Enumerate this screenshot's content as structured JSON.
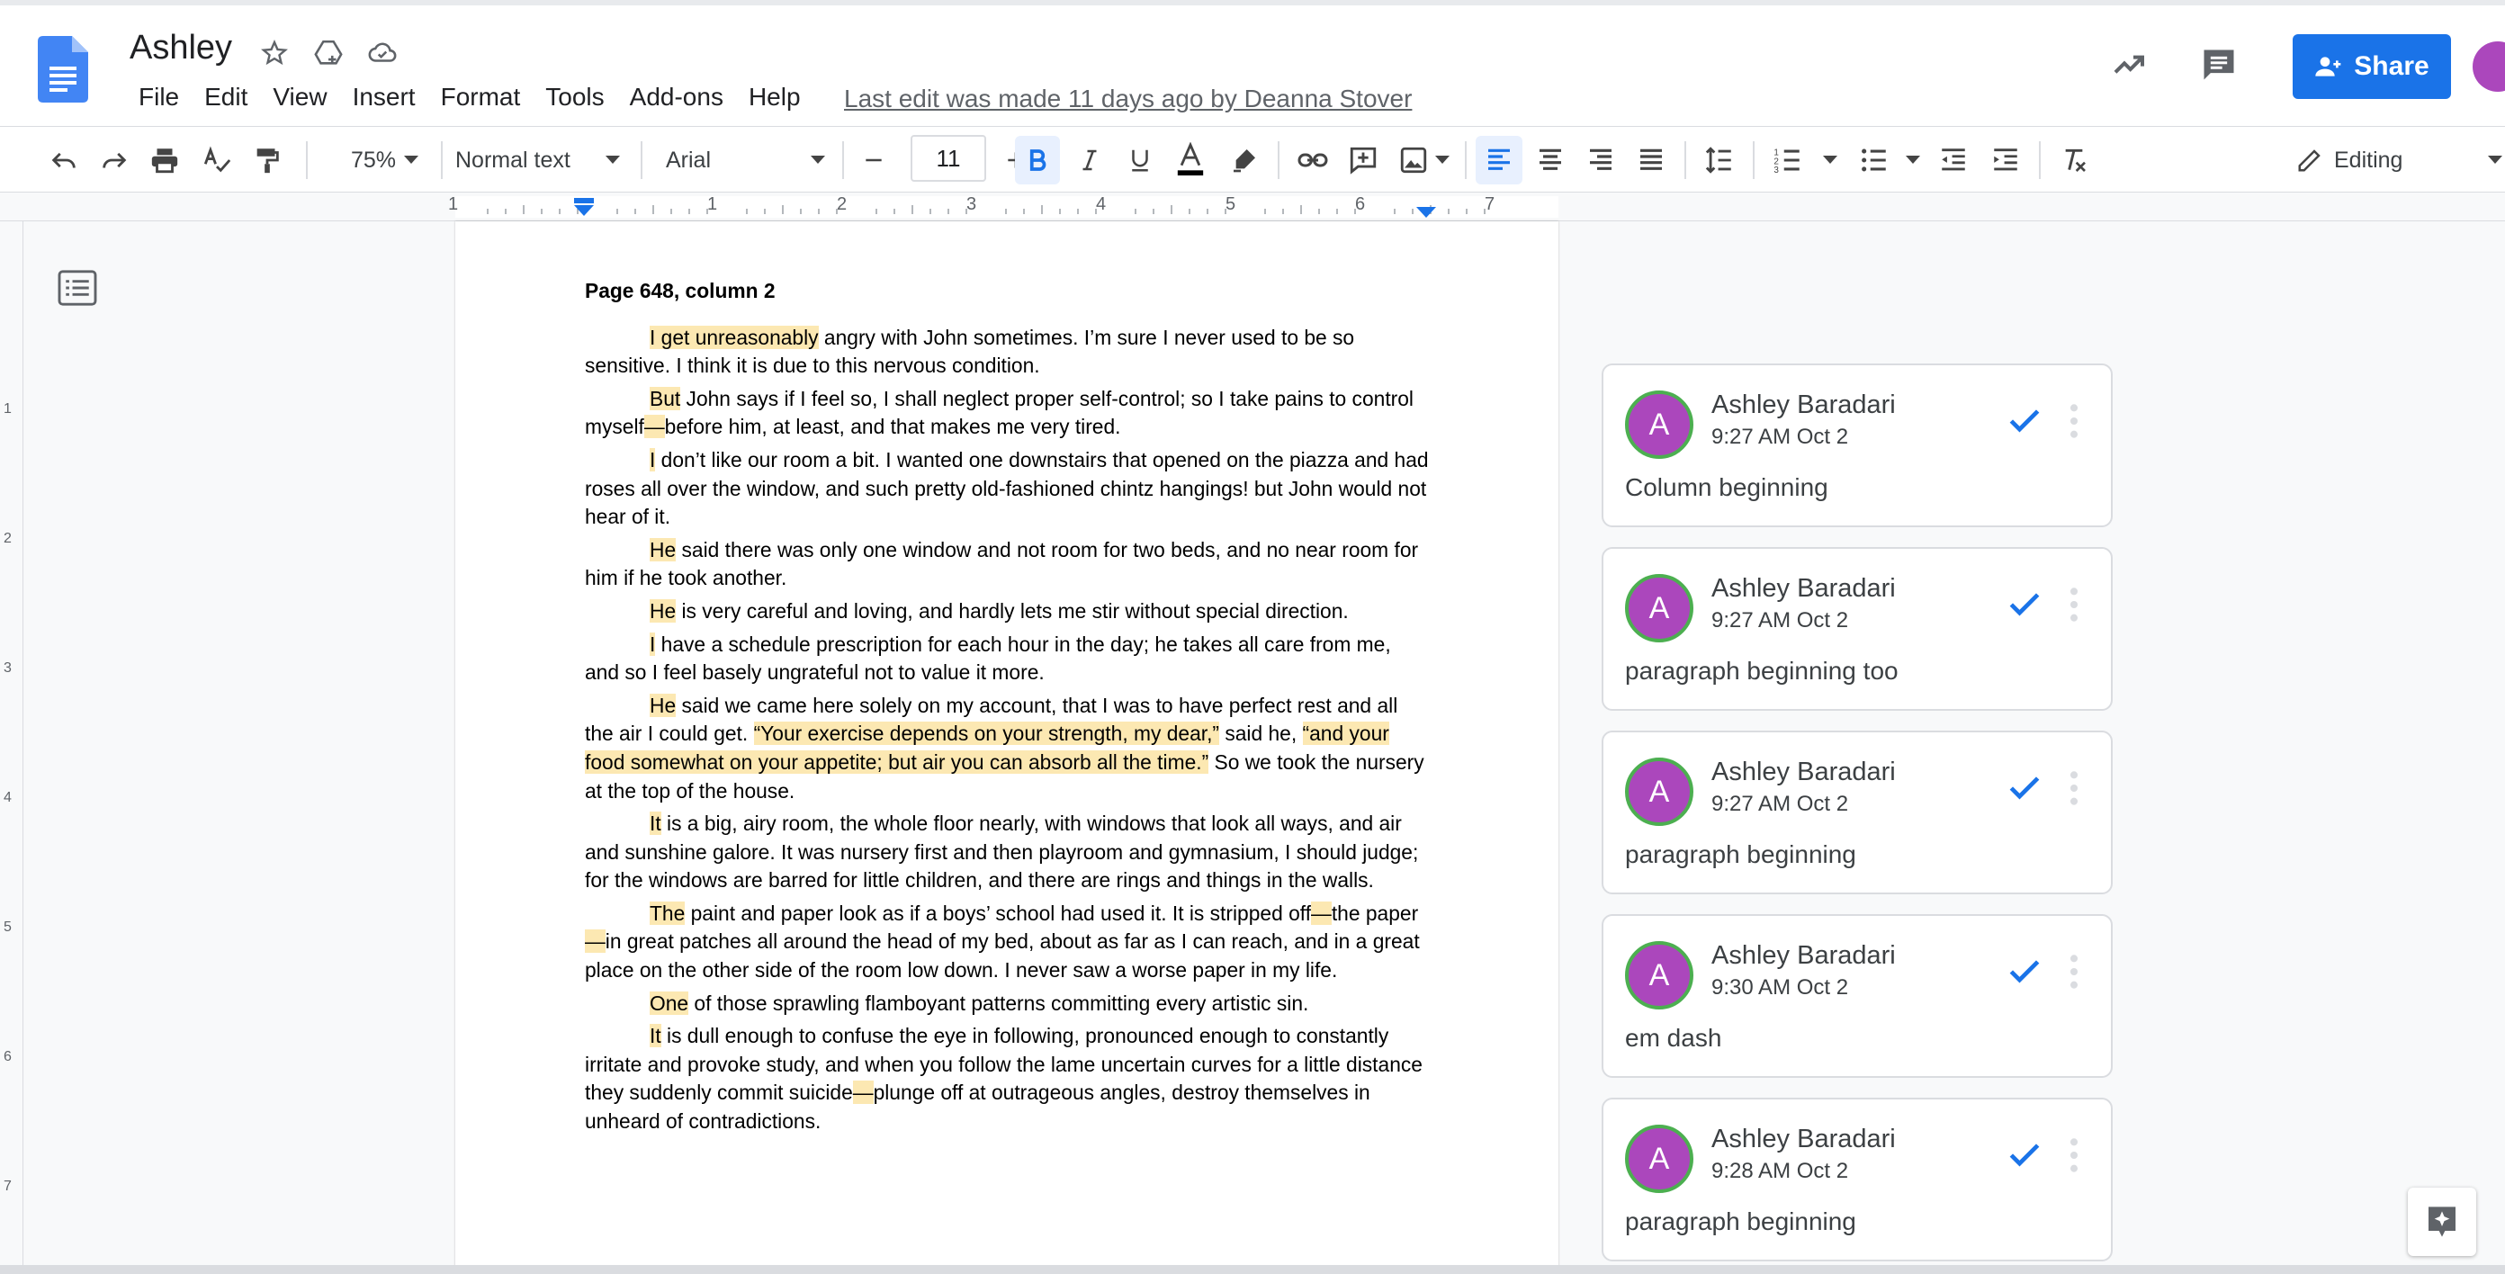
{
  "doc": {
    "title": "Ashley",
    "last_edit": "Last edit was made 11 days ago by Deanna Stover"
  },
  "menu": [
    "File",
    "Edit",
    "View",
    "Insert",
    "Format",
    "Tools",
    "Add-ons",
    "Help"
  ],
  "share": {
    "label": "Share"
  },
  "toolbar": {
    "zoom": "75%",
    "style": "Normal text",
    "font": "Arial",
    "font_size": "11",
    "mode": "Editing"
  },
  "ruler": [
    "1",
    "1",
    "2",
    "3",
    "4",
    "5",
    "6",
    "7"
  ],
  "vruler": [
    "1",
    "2",
    "3",
    "4",
    "5",
    "6",
    "7"
  ],
  "document": {
    "heading": "Page 648, column 2",
    "paragraphs": [
      {
        "hl": "I get unreasonably",
        "rest": " angry with John sometimes. I’m sure I never used to be so sensitive. I think it is due to this nervous condition."
      },
      {
        "hl": "But",
        "rest": " John says if I feel so, I shall neglect proper self-control; so I take pains to control myself",
        "dash": "—",
        "tail": "before him, at least, and that makes me very tired."
      },
      {
        "hl": "I",
        "rest": " don’t like our room a bit. I wanted one downstairs that opened on the piazza and had roses all over the window, and such pretty old-fashioned chintz hangings! but John would not hear of it."
      },
      {
        "hl": "He",
        "rest": " said there was only one window and not room for two beds, and no near room for him if he took another."
      },
      {
        "hl": "He",
        "rest": " is very careful and loving, and hardly lets me stir without special direction."
      },
      {
        "hl": "I",
        "rest": " have a schedule prescription for each hour in the day; he takes all care from me, and so I feel basely ungrateful not to value it more."
      },
      {
        "hl": "He",
        "rest": " said we came here solely on my account, that I was to have perfect rest and all the air I could get. ",
        "q1": "“Your exercise depends on your strength, my dear,”",
        "mid": " said he, ",
        "q2": "“and your food somewhat on your appetite; but air you can absorb all the time.”",
        "tail": " So we took the nursery at the top of the house."
      },
      {
        "hl": "It",
        "rest": " is a big, airy room, the whole floor nearly, with windows that look all ways, and air and sunshine galore. It was nursery first and then playroom and gymnasium, I should judge; for the windows are barred for little children, and there are rings and things in the walls."
      },
      {
        "hl": "The",
        "rest": " paint and paper look as if a boys’ school had used it. It is stripped off",
        "d1": "—",
        "r2": "the paper",
        "d2": "—",
        "tail": "in great patches all around the head of my bed, about as far as I can reach, and in a great place on the other side of the room low down. I never saw a worse paper in my life."
      },
      {
        "hl": "One",
        "rest": " of those sprawling flamboyant patterns committing every artistic sin."
      },
      {
        "hl": "It",
        "rest": " is dull enough to confuse the eye in following, pronounced enough to constantly irritate and provoke study, and when you follow the lame uncertain curves for a little distance they suddenly commit suicide",
        "dash": "—",
        "tail": "plunge off at outrageous angles, destroy themselves in unheard of contradictions."
      }
    ]
  },
  "comments": [
    {
      "initial": "A",
      "author": "Ashley Baradari",
      "time": "9:27 AM Oct 2",
      "text": "Column beginning"
    },
    {
      "initial": "A",
      "author": "Ashley Baradari",
      "time": "9:27 AM Oct 2",
      "text": "paragraph beginning too"
    },
    {
      "initial": "A",
      "author": "Ashley Baradari",
      "time": "9:27 AM Oct 2",
      "text": "paragraph beginning"
    },
    {
      "initial": "A",
      "author": "Ashley Baradari",
      "time": "9:30 AM Oct 2",
      "text": "em dash"
    },
    {
      "initial": "A",
      "author": "Ashley Baradari",
      "time": "9:28 AM Oct 2",
      "text": "paragraph beginning"
    }
  ],
  "colors": {
    "accent": "#1a73e8",
    "highlight": "#fce8b2",
    "avatar": "#ab47bc",
    "avatar_ring": "#4caf50"
  }
}
